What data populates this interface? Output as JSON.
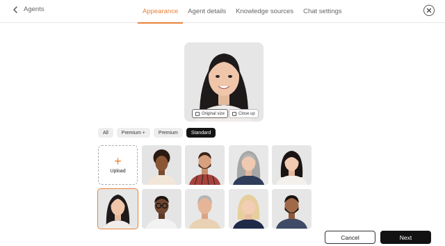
{
  "header": {
    "back_label": "Agents",
    "tabs": [
      {
        "label": "Appearance",
        "active": true
      },
      {
        "label": "Agent details",
        "active": false
      },
      {
        "label": "Knowledge sources",
        "active": false
      },
      {
        "label": "Chat settings",
        "active": false
      }
    ],
    "accent_color": "#e8823a"
  },
  "preview": {
    "original_size_label": "Original size",
    "close_up_label": "Close up"
  },
  "filters": {
    "options": [
      "All",
      "Premium +",
      "Premium",
      "Standard"
    ],
    "selected": "Standard"
  },
  "grid": {
    "upload_label": "Upload",
    "upload_icon": "plus-icon",
    "avatars": [
      {
        "name": "avatar-woman-curly-hair",
        "selected": false
      },
      {
        "name": "avatar-man-beard-plaid-shirt",
        "selected": false
      },
      {
        "name": "avatar-older-woman-gray-hair",
        "selected": false
      },
      {
        "name": "avatar-woman-dark-bob",
        "selected": false
      },
      {
        "name": "avatar-asian-woman-long-hair",
        "selected": true
      },
      {
        "name": "avatar-man-glasses",
        "selected": false
      },
      {
        "name": "avatar-older-man-gray-hair",
        "selected": false
      },
      {
        "name": "avatar-blonde-woman",
        "selected": false
      },
      {
        "name": "avatar-man-dark-beard",
        "selected": false
      }
    ]
  },
  "footer": {
    "cancel_label": "Cancel",
    "next_label": "Next"
  }
}
